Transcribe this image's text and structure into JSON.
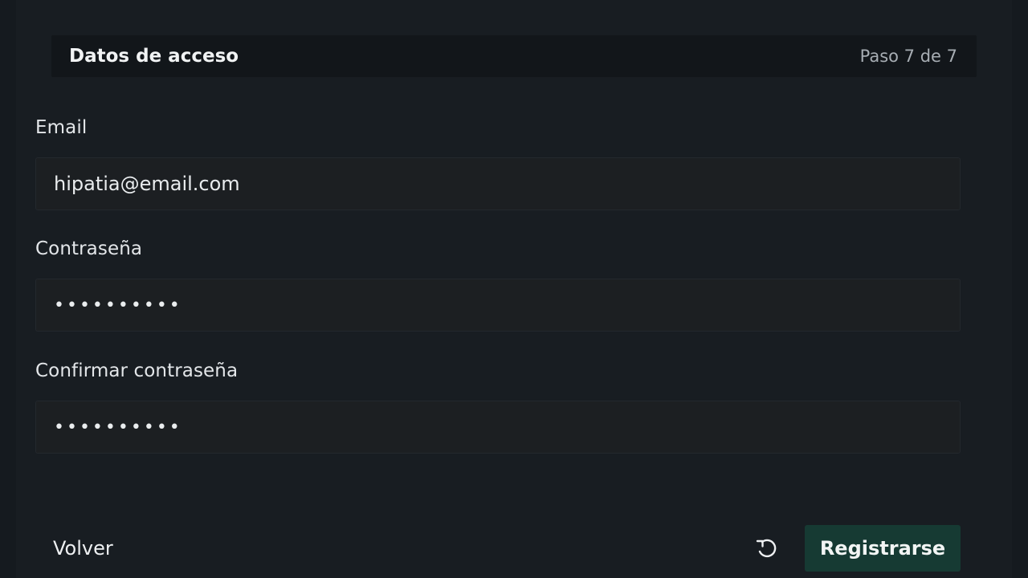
{
  "section": {
    "title": "Datos de acceso",
    "step": "Paso 7 de 7"
  },
  "fields": {
    "email": {
      "label": "Email",
      "value": "hipatia@email.com"
    },
    "password": {
      "label": "Contraseña",
      "value": "••••••••••"
    },
    "confirm_password": {
      "label": "Confirmar contraseña",
      "value": "••••••••••"
    }
  },
  "actions": {
    "back_label": "Volver",
    "reset_icon": "reset-icon",
    "submit_label": "Registrarse"
  },
  "colors": {
    "background": "#181d22",
    "header_background": "#12161a",
    "input_background": "#1c1f22",
    "submit_background": "#163a33",
    "text": "#f1f3f4",
    "muted_text": "#a7adb3"
  }
}
